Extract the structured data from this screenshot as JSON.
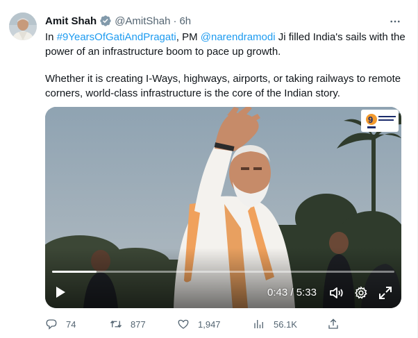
{
  "tweet": {
    "author_name": "Amit Shah",
    "author_handle": "@AmitShah",
    "separator": "·",
    "time": "6h",
    "text_p1_prefix": "In ",
    "hashtag": "#9YearsOfGatiAndPragati",
    "text_p1_mid": ", PM ",
    "mention": "@narendramodi",
    "text_p1_suffix": " Ji filled India's sails with the power of an infrastructure boom to pace up growth.",
    "text_p2": "Whether it is creating I-Ways, highways, airports, or taking railways to remote corners, world-class infrastructure is the core of the Indian story."
  },
  "video": {
    "elapsed": "0:43",
    "duration": "5:33",
    "time_separator": "/",
    "progress_fraction": 0.129,
    "badge_text": "9"
  },
  "actions": {
    "replies": "74",
    "retweets": "877",
    "likes": "1,947",
    "views": "56.1K"
  },
  "colors": {
    "link": "#1d9bf0",
    "verified": "#829aab",
    "secondary_text": "#536471",
    "primary_text": "#0f1419"
  },
  "icons": [
    "verified-badge-icon",
    "more-icon",
    "play-icon",
    "volume-icon",
    "settings-icon",
    "fullscreen-icon",
    "reply-icon",
    "retweet-icon",
    "like-icon",
    "views-icon",
    "share-icon"
  ]
}
